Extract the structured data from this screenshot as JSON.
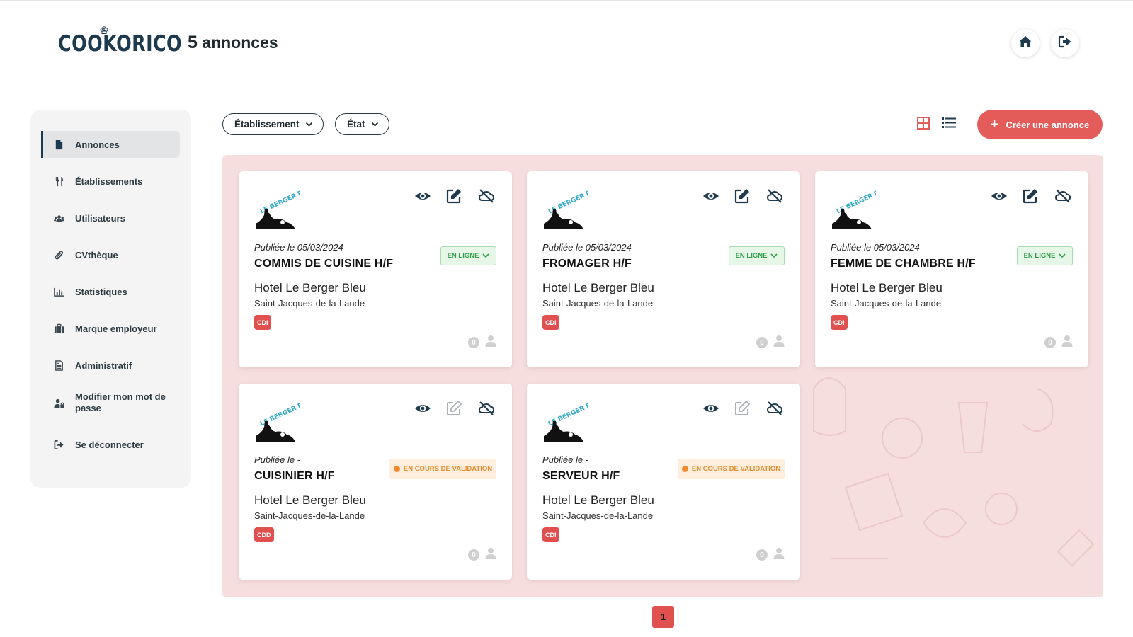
{
  "header": {
    "logo_text": "COOKORICO",
    "count": "5",
    "count_suffix": "annonces",
    "home_icon": "home-icon",
    "logout_icon": "logout-icon"
  },
  "sidebar": {
    "items": [
      {
        "label": "Annonces",
        "icon": "document-icon",
        "active": true
      },
      {
        "label": "Établissements",
        "icon": "fork-knife-icon"
      },
      {
        "label": "Utilisateurs",
        "icon": "users-icon"
      },
      {
        "label": "CVthèque",
        "icon": "paperclip-icon"
      },
      {
        "label": "Statistiques",
        "icon": "bar-chart-icon"
      },
      {
        "label": "Marque employeur",
        "icon": "briefcase-icon"
      },
      {
        "label": "Administratif",
        "icon": "file-invoice-icon"
      },
      {
        "label": "Modifier mon mot de passe",
        "icon": "user-lock-icon"
      },
      {
        "label": "Se déconnecter",
        "icon": "logout-icon"
      }
    ]
  },
  "toolbar": {
    "filter_establishment": "Établissement",
    "filter_state": "État",
    "view_grid_icon": "grid-view-icon",
    "view_list_icon": "list-view-icon",
    "create_plus": "+",
    "create_label": "Créer une annonce"
  },
  "listings": [
    {
      "published": "Publiée le 05/03/2024",
      "title": "COMMIS DE CUISINE H/F",
      "hotel": "Hotel Le Berger Bleu",
      "city": "Saint-Jacques-de-la-Lande",
      "contract": "CDI",
      "status": "EN LIGNE",
      "candidates": "0"
    },
    {
      "published": "Publiée le 05/03/2024",
      "title": "FROMAGER H/F",
      "hotel": "Hotel Le Berger Bleu",
      "city": "Saint-Jacques-de-la-Lande",
      "contract": "CDI",
      "status": "EN LIGNE",
      "candidates": "0"
    },
    {
      "published": "Publiée le 05/03/2024",
      "title": "FEMME DE CHAMBRE H/F",
      "hotel": "Hotel Le Berger Bleu",
      "city": "Saint-Jacques-de-la-Lande",
      "contract": "CDI",
      "status": "EN LIGNE",
      "candidates": "0"
    },
    {
      "published": "Publiée le -",
      "title": "CUISINIER H/F",
      "hotel": "Hotel Le Berger Bleu",
      "city": "Saint-Jacques-de-la-Lande",
      "contract": "CDD",
      "status": "EN COURS DE VALIDATION",
      "candidates": "0"
    },
    {
      "published": "Publiée le -",
      "title": "SERVEUR H/F",
      "hotel": "Hotel Le Berger Bleu",
      "city": "Saint-Jacques-de-la-Lande",
      "contract": "CDI",
      "status": "EN COURS DE VALIDATION",
      "candidates": "0"
    }
  ],
  "brand_logo_text": "LE BERGER BLEU",
  "pagination": {
    "current": "1"
  },
  "colors": {
    "accent": "#e45c5a",
    "navy": "#1d3a4f",
    "content_bg": "#f6dede",
    "online_green": "#2e9e48",
    "pending_orange": "#e38e2f"
  }
}
